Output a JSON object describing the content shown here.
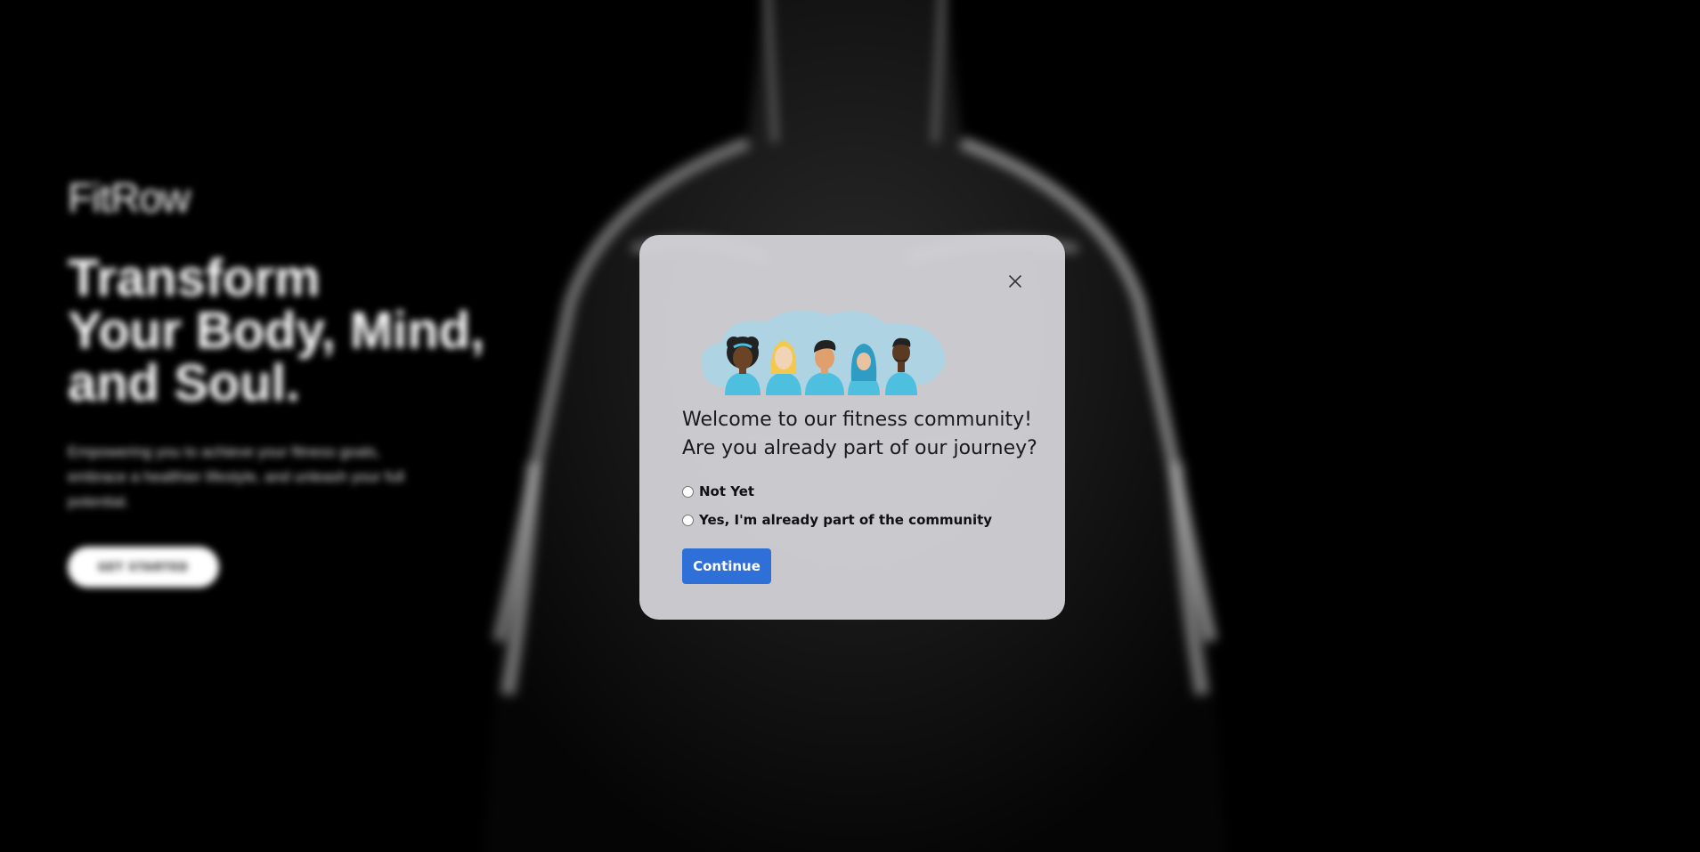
{
  "background": {
    "brand": "FitRow",
    "headline": [
      "Transform",
      "Your Body, Mind,",
      "and Soul."
    ],
    "tagline": "Empowering you to achieve your fitness goals, embrace a healthier lifestyle, and unleash your full potential.",
    "cta_label": "GET STARTED"
  },
  "modal": {
    "welcome_line1": "Welcome to our fitness community!",
    "welcome_line2": "Are you already part of our journey?",
    "options": [
      {
        "label": "Not Yet",
        "value": "not_yet",
        "checked": false
      },
      {
        "label": "Yes, I'm already part of the community",
        "value": "yes",
        "checked": false
      }
    ],
    "continue_label": "Continue",
    "close_icon": "close-icon",
    "illustration_icon": "community-people-icon"
  },
  "colors": {
    "accent": "#2f6fd8",
    "modal_bg": "#d7d7dc",
    "person_shirt": "#4fbfe0",
    "cloud": "#a9d5e6"
  }
}
